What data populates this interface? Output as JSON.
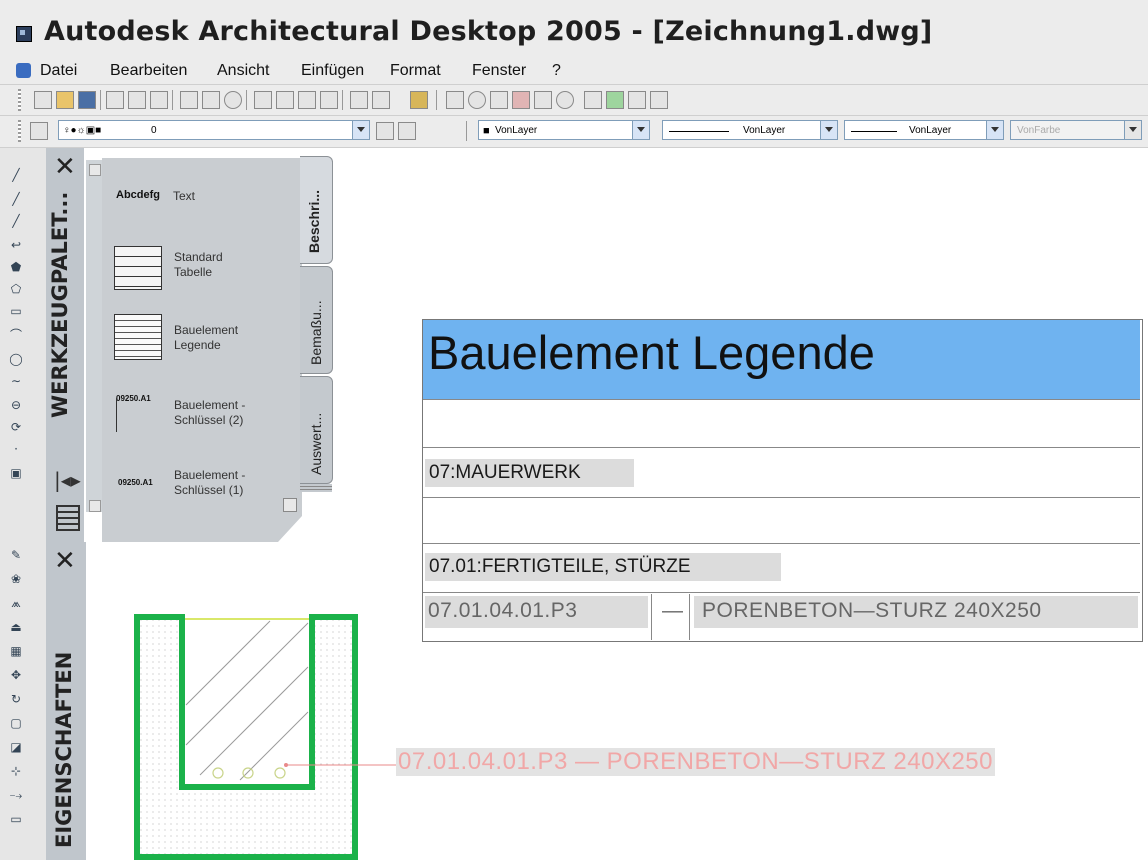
{
  "window": {
    "title": "Autodesk Architectural Desktop 2005 - [Zeichnung1.dwg]"
  },
  "menu": [
    "Datei",
    "Bearbeiten",
    "Ansicht",
    "Einfügen",
    "Format",
    "Fenster",
    "?"
  ],
  "layer_toolbar": {
    "layer_name": "0",
    "color": "VonLayer",
    "linetype": "VonLayer",
    "lineweight": "VonLayer",
    "plotstyle": "VonFarbe"
  },
  "tool_palette": {
    "title": "WERKZEUGPALET...",
    "tabs": [
      "Beschri...",
      "Bemaßu...",
      "Auswert..."
    ],
    "items": [
      {
        "icon_text": "Abcdefg",
        "label": "Text"
      },
      {
        "label": "Standard Tabelle"
      },
      {
        "label": "Bauelement Legende"
      },
      {
        "icon_text": "09250.A1",
        "label": "Bauelement -Schlüssel (2)"
      },
      {
        "icon_text": "09250.A1",
        "label": "Bauelement -Schlüssel (1)"
      }
    ]
  },
  "properties_palette": {
    "title": "EIGENSCHAFTEN"
  },
  "legend": {
    "title": "Bauelement Legende",
    "rows": [
      {
        "text": ""
      },
      {
        "text": "07:MAUERWERK"
      },
      {
        "text": ""
      },
      {
        "text": "07.01:FERTIGTEILE, STÜRZE"
      }
    ],
    "data_row": {
      "code": "07.01.04.01.P3",
      "dash": "—",
      "description": "PORENBETON—STURZ 240X250"
    }
  },
  "annotation": {
    "text": "07.01.04.01.P3 — PORENBETON—STURZ 240X250"
  },
  "colors": {
    "legend_header": "#6fb3f0",
    "lintel_outline": "#1bb24a",
    "leader": "#e98a8a"
  }
}
